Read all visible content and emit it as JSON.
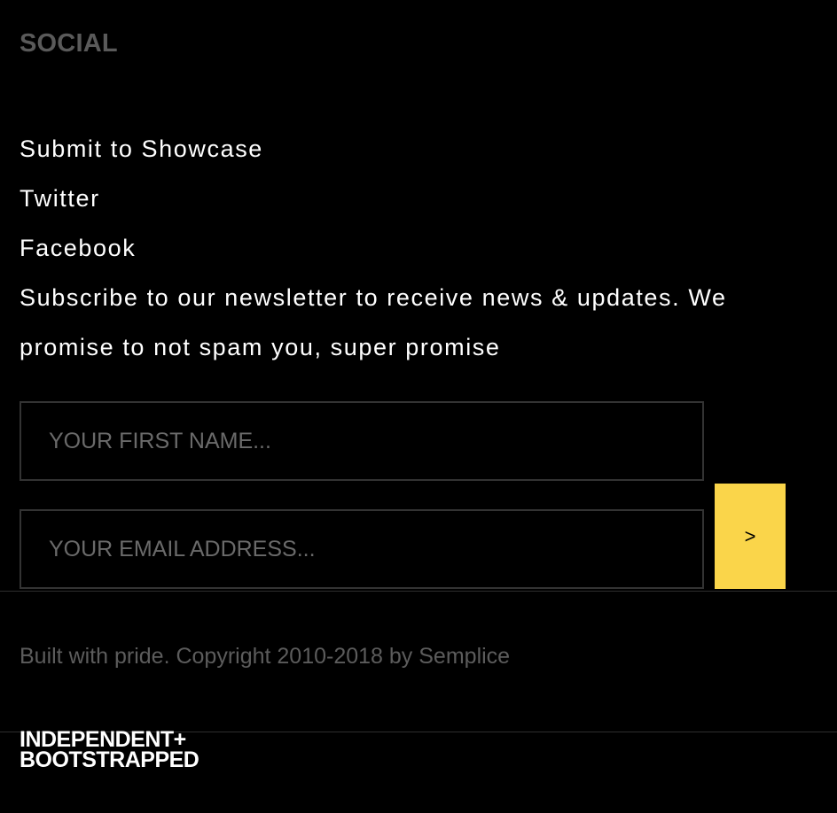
{
  "social": {
    "heading": "SOCIAL",
    "links": [
      {
        "label": "Submit to Showcase"
      },
      {
        "label": "Twitter"
      },
      {
        "label": "Facebook"
      }
    ]
  },
  "newsletter": {
    "description": "Subscribe to our newsletter to receive news & updates. We promise to not spam you, super promise",
    "first_name": {
      "placeholder": "YOUR FIRST NAME...",
      "value": ""
    },
    "email": {
      "placeholder": "YOUR EMAIL ADDRESS...",
      "value": ""
    },
    "submit_label": ">"
  },
  "footer": {
    "copyright": "Built with pride. Copyright 2010-2018 by Semplice",
    "badge_line1": "INDEPENDENT+",
    "badge_line2": "BOOTSTRAPPED"
  },
  "colors": {
    "background": "#000000",
    "accent": "#fad54a",
    "heading": "#5a5a5a",
    "muted_text": "#5c5c5c",
    "border": "#333333"
  }
}
